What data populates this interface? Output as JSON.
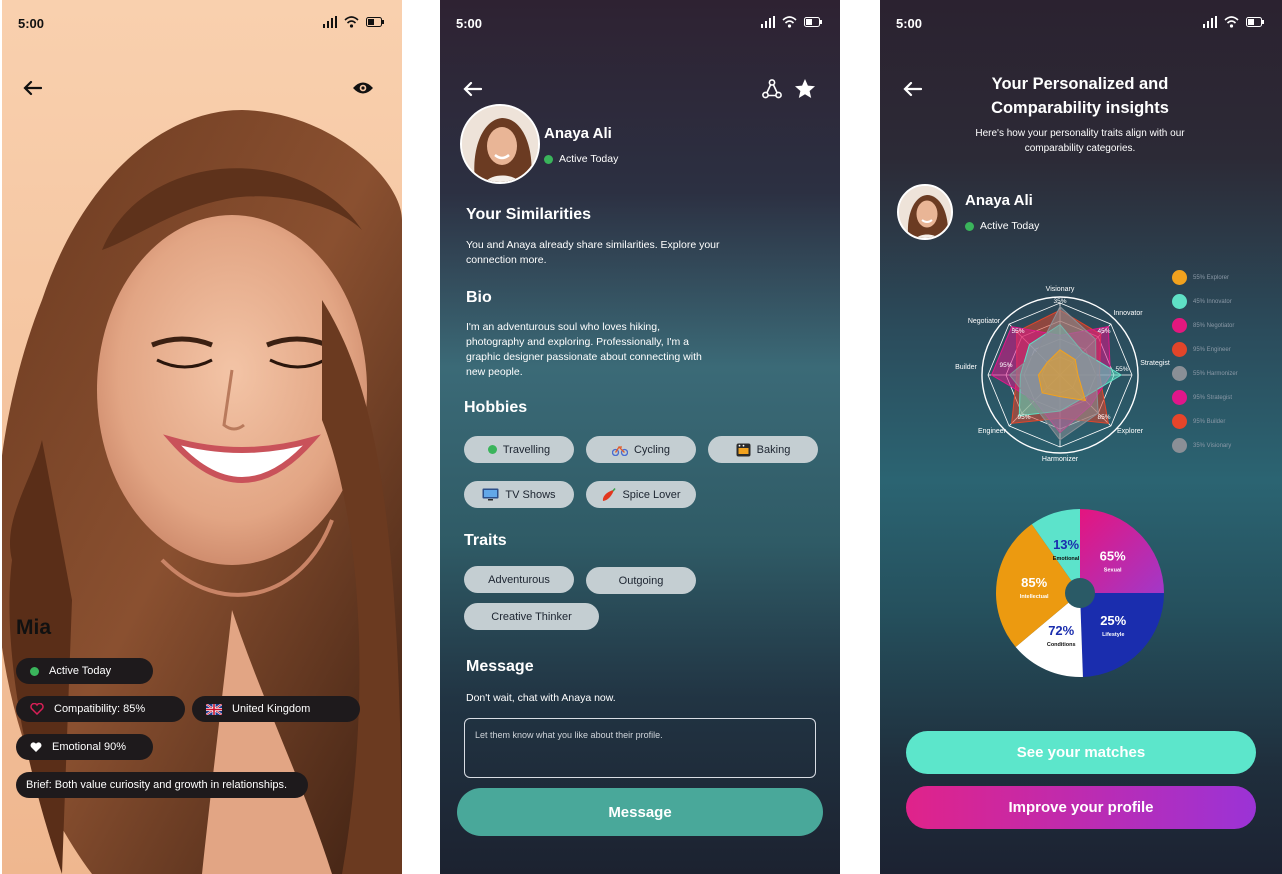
{
  "status": {
    "time": "5:00"
  },
  "profile_photo": {
    "name": "Mia",
    "active": "Active Today",
    "compatibility": "Compatibility: 85%",
    "country": "United Kingdom",
    "emotional": "Emotional 90%",
    "brief": "Brief: Both value curiosity and growth in relationships."
  },
  "profile_detail": {
    "name": "Anaya Ali",
    "active": "Active Today",
    "similarities_title": "Your Similarities",
    "similarities_text": "You and Anaya already share similarities. Explore your connection more.",
    "bio_title": "Bio",
    "bio_text": "I'm an adventurous soul who loves hiking, photography and exploring. Professionally, I'm a graphic designer passionate about connecting with new people.",
    "hobbies_title": "Hobbies",
    "hobbies": [
      "Travelling",
      "Cycling",
      "Baking",
      "TV Shows",
      "Spice Lover"
    ],
    "traits_title": "Traits",
    "traits": [
      "Adventurous",
      "Outgoing",
      "Creative Thinker"
    ],
    "message_title": "Message",
    "message_sub": "Don't wait, chat with Anaya now.",
    "message_placeholder": "Let them know what you like about their profile.",
    "message_button": "Message"
  },
  "insights": {
    "title": "Your Personalized and Comparability insights",
    "subtitle": "Here's how your personality traits align with our comparability categories.",
    "name": "Anaya Ali",
    "active": "Active Today",
    "see_matches": "See your matches",
    "improve_profile": "Improve your profile",
    "legend": [
      {
        "label": "55% Explorer",
        "color": "#f2a21e"
      },
      {
        "label": "45% Innovator",
        "color": "#5fe0c5"
      },
      {
        "label": "85% Negotiator",
        "color": "#e4177e"
      },
      {
        "label": "95% Engineer",
        "color": "#e2452a"
      },
      {
        "label": "55% Harmonizer",
        "color": "#8a8f96"
      },
      {
        "label": "95% Strategist",
        "color": "#e0168a"
      },
      {
        "label": "95% Builder",
        "color": "#e6452a"
      },
      {
        "label": "35% Visionary",
        "color": "#8a8f96"
      }
    ]
  },
  "chart_data": [
    {
      "type": "radar",
      "categories": [
        "Visionary",
        "Innovator",
        "Strategist",
        "Explorer",
        "Harmonizer",
        "Engineer",
        "Builder",
        "Negotiator"
      ],
      "value_labels": [
        "35%",
        "45%",
        "55%",
        "85%",
        "",
        "95%",
        "95%",
        "55%"
      ]
    },
    {
      "type": "pie",
      "labels": [
        "Sexual",
        "Lifestyle",
        "Conditions",
        "Intellectual",
        "Emotional"
      ],
      "values": [
        65,
        25,
        72,
        85,
        13
      ],
      "value_labels": [
        "65%",
        "25%",
        "72%",
        "85%",
        "13%"
      ],
      "colors": [
        "#d6188c",
        "#1a2dae",
        "#ffffff",
        "#ec9a10",
        "#5ce3cb"
      ]
    }
  ]
}
